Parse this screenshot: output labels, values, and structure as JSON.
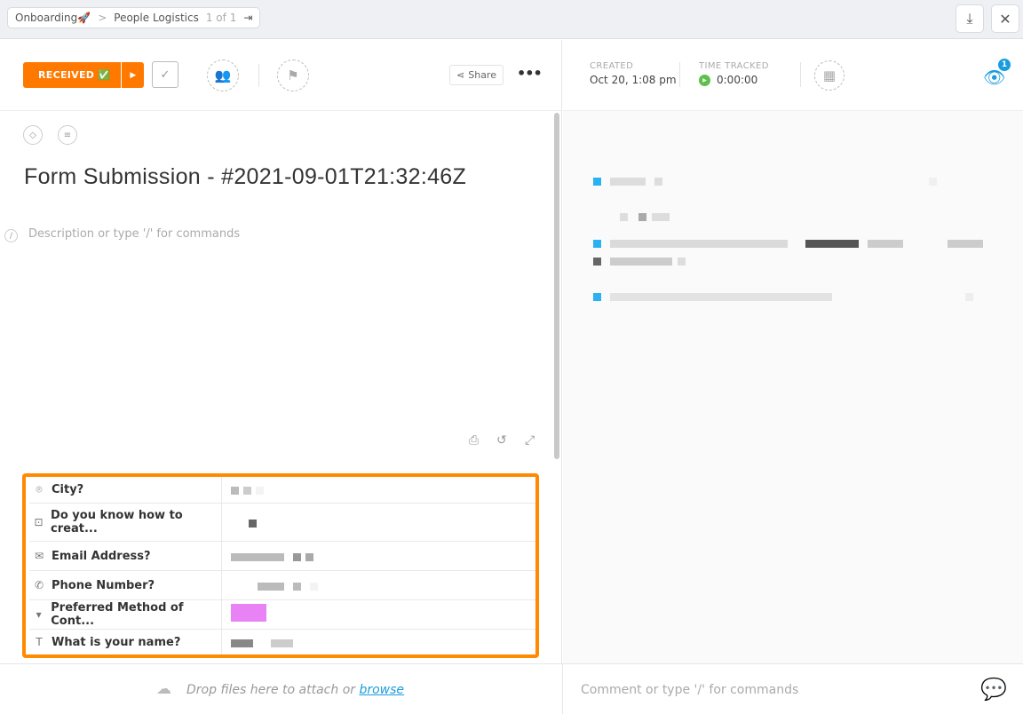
{
  "breadcrumb": {
    "space": "Onboarding🚀",
    "separator": ">",
    "list": "People Logistics",
    "counter": "1 of 1"
  },
  "toolbar": {
    "status": "RECEIVED ✅",
    "share": "Share",
    "more": "•••"
  },
  "task": {
    "title": "Form Submission - #2021-09-01T21:32:46Z",
    "description_placeholder": "Description or type '/' for commands"
  },
  "fields": [
    {
      "icon": "location-icon",
      "label": "City?"
    },
    {
      "icon": "text-area-icon",
      "label": "Do you know how to creat..."
    },
    {
      "icon": "email-icon",
      "label": "Email Address?"
    },
    {
      "icon": "phone-icon",
      "label": "Phone Number?"
    },
    {
      "icon": "dropdown-icon",
      "label": "Preferred Method of Cont..."
    },
    {
      "icon": "text-icon",
      "label": "What is your name?"
    }
  ],
  "meta": {
    "created_label": "CREATED",
    "created_value": "Oct 20, 1:08 pm",
    "time_label": "TIME TRACKED",
    "time_value": "0:00:00",
    "watchers": "1"
  },
  "bottom": {
    "drop_text": "Drop files here to attach or ",
    "browse": "browse",
    "comment_placeholder": "Comment or type '/' for commands"
  },
  "colors": {
    "status": "#ff7800",
    "highlight": "#ff8a00",
    "accent": "#1a9ce0",
    "play": "#5cc14a"
  }
}
